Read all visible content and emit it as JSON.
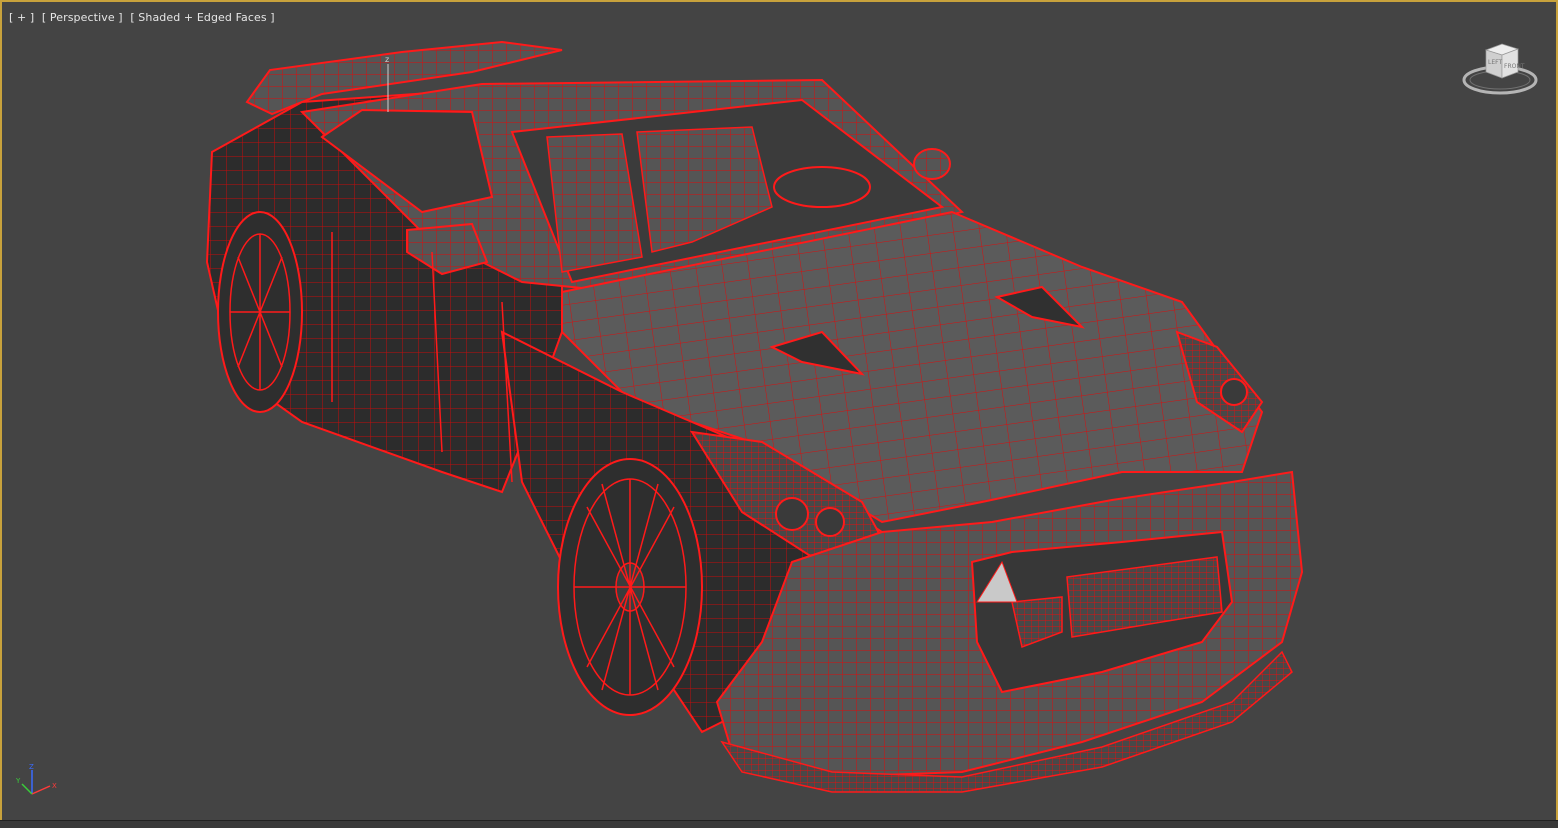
{
  "viewport": {
    "label_parts": [
      "[ + ]",
      "[ Perspective ]",
      "[ Shaded + Edged Faces ]"
    ],
    "background_color": "#444444",
    "active_border_color": "#c8a23c",
    "wire_color": "#e01010",
    "shaded_color": "#5a5a5a"
  },
  "viewcube": {
    "face_label": "FRONT",
    "side_label": "LEFT"
  },
  "axis_tripod": {
    "z_label": "Z",
    "x_label": "X",
    "y_label": "Y"
  }
}
